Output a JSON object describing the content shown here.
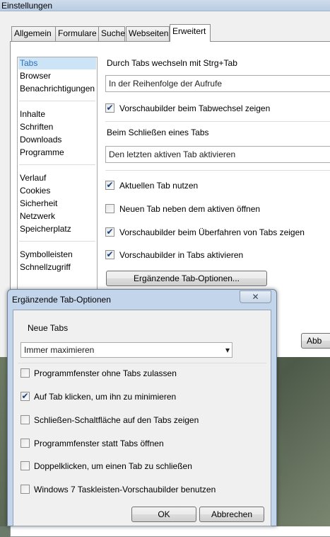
{
  "window": {
    "title": "Einstellungen"
  },
  "tabs": [
    "Allgemein",
    "Formulare",
    "Suche",
    "Webseiten",
    "Erweitert"
  ],
  "sidebar": {
    "items": [
      "Tabs",
      "Browser",
      "Benachrichtigungen",
      "Inhalte",
      "Schriften",
      "Downloads",
      "Programme",
      "Verlauf",
      "Cookies",
      "Sicherheit",
      "Netzwerk",
      "Speicherplatz",
      "Symbolleisten",
      "Schnellzugriff"
    ],
    "selected": "Tabs"
  },
  "tabs_panel": {
    "switch_label": "Durch Tabs wechseln mit Strg+Tab",
    "switch_value": "In der Reihenfolge der Aufrufe",
    "preview_on_switch": {
      "label": "Vorschaubilder beim Tabwechsel zeigen",
      "checked": true
    },
    "close_label": "Beim Schließen eines Tabs",
    "close_value": "Den letzten aktiven Tab aktivieren",
    "options": [
      {
        "label": "Aktuellen Tab nutzen",
        "checked": true
      },
      {
        "label": "Neuen Tab neben dem aktiven öffnen",
        "checked": false
      },
      {
        "label": "Vorschaubilder beim Überfahren von Tabs zeigen",
        "checked": true
      },
      {
        "label": "Vorschaubilder in Tabs aktivieren",
        "checked": true
      }
    ],
    "more_button": "Ergänzende Tab-Optionen...",
    "partial_button": "Abb"
  },
  "dialog": {
    "title": "Ergänzende Tab-Optionen",
    "close_glyph": "✕",
    "new_tabs_label": "Neue Tabs",
    "new_tabs_value": "Immer maximieren",
    "options": [
      {
        "label": "Programmfenster ohne Tabs zulassen",
        "checked": false
      },
      {
        "label": "Auf Tab klicken, um ihn zu minimieren",
        "checked": true
      },
      {
        "label": "Schließen-Schaltfläche auf den Tabs zeigen",
        "checked": false
      },
      {
        "label": "Programmfenster statt Tabs öffnen",
        "checked": false
      },
      {
        "label": "Doppelklicken, um einen Tab zu schließen",
        "checked": false
      },
      {
        "label": "Windows 7 Taskleisten-Vorschaubilder benutzen",
        "checked": false
      }
    ],
    "ok": "OK",
    "cancel": "Abbrechen"
  },
  "icons": {
    "check": "✔",
    "dropdown_arrow": "▾"
  }
}
